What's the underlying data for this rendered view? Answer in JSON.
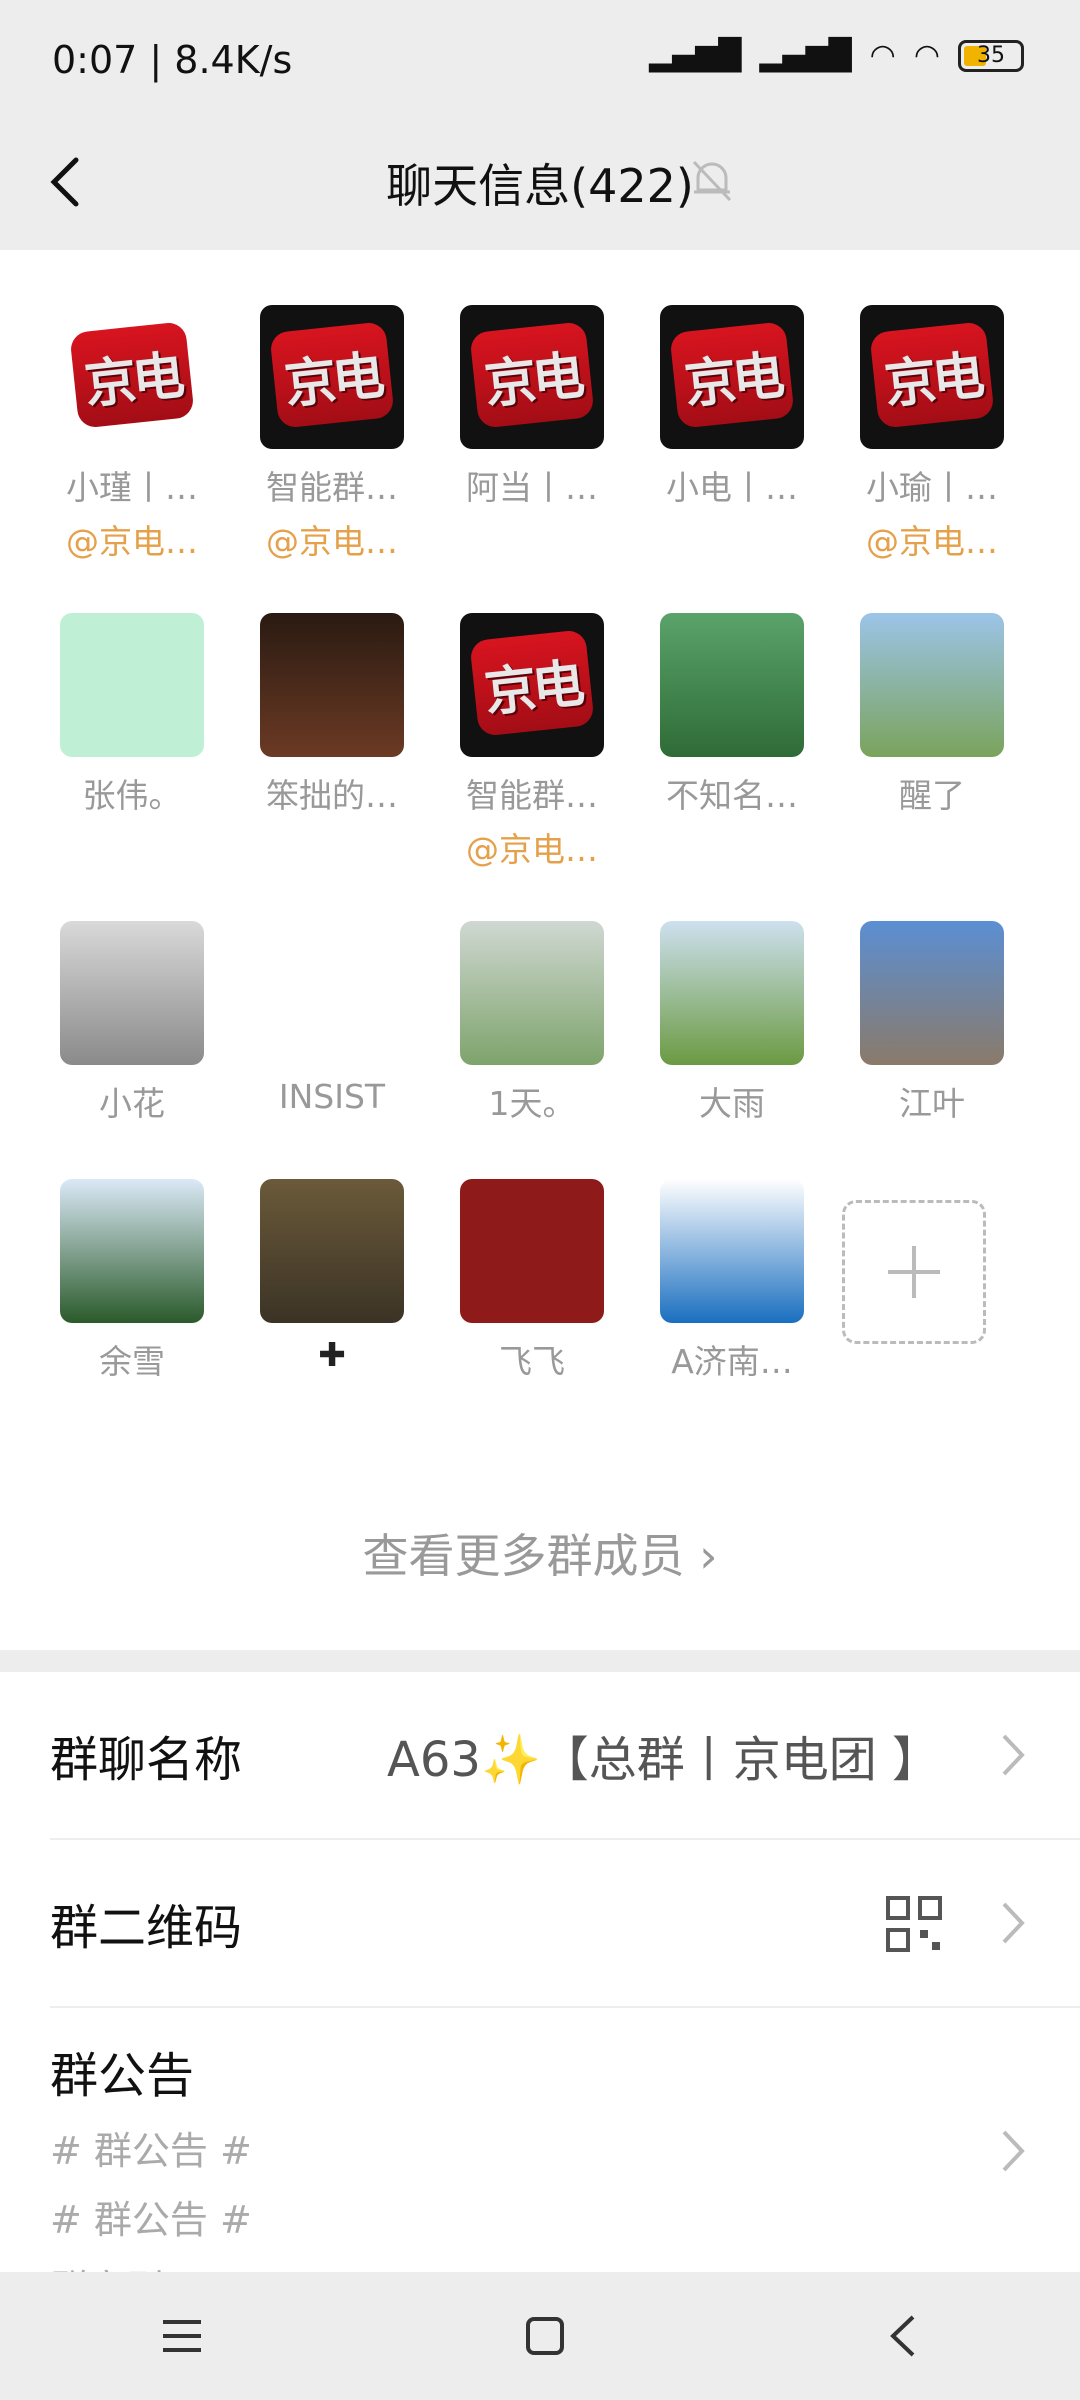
{
  "status_bar": {
    "time": "0:07 | 8.4K/s",
    "battery": "35"
  },
  "nav": {
    "title": "聊天信息(422)"
  },
  "members": [
    {
      "name": "小瑾丨…",
      "tag": "@京电…",
      "avatar": "jd-logo-light"
    },
    {
      "name": "智能群…",
      "tag": "@京电…",
      "avatar": "jd-logo-dark"
    },
    {
      "name": "阿当丨…",
      "tag": "",
      "avatar": "jd-logo-dark"
    },
    {
      "name": "小电丨…",
      "tag": "",
      "avatar": "jd-logo-dark"
    },
    {
      "name": "小瑜丨…",
      "tag": "@京电…",
      "avatar": "jd-logo-dark"
    },
    {
      "name": "张伟。",
      "tag": "",
      "avatar": "lemon"
    },
    {
      "name": "笨拙的…",
      "tag": "",
      "avatar": "fireworks"
    },
    {
      "name": "智能群…",
      "tag": "@京电…",
      "avatar": "jd-logo-dark"
    },
    {
      "name": "不知名…",
      "tag": "",
      "avatar": "field"
    },
    {
      "name": "醒了",
      "tag": "",
      "avatar": "lake"
    },
    {
      "name": "小花",
      "tag": "",
      "avatar": "kids"
    },
    {
      "name": "INSIST",
      "tag": "",
      "avatar": "toast"
    },
    {
      "name": "1天。",
      "tag": "",
      "avatar": "clouds"
    },
    {
      "name": "大雨",
      "tag": "",
      "avatar": "grassland"
    },
    {
      "name": "江叶",
      "tag": "",
      "avatar": "beach"
    },
    {
      "name": "余雪",
      "tag": "",
      "avatar": "sky"
    },
    {
      "name": "✚",
      "tag": "",
      "avatar": "cat"
    },
    {
      "name": "飞飞",
      "tag": "",
      "avatar": "red-card"
    },
    {
      "name": "A济南…",
      "tag": "",
      "avatar": "xqj"
    }
  ],
  "more_members": "查看更多群成员 ›",
  "settings": {
    "group_name_label": "群聊名称",
    "group_name_value": "A63✨【总群丨京电团 】",
    "qr_label": "群二维码",
    "notice_label": "群公告",
    "notice_lines": [
      "# 群公告 #",
      "# 群公告 #",
      "群守则："
    ]
  }
}
